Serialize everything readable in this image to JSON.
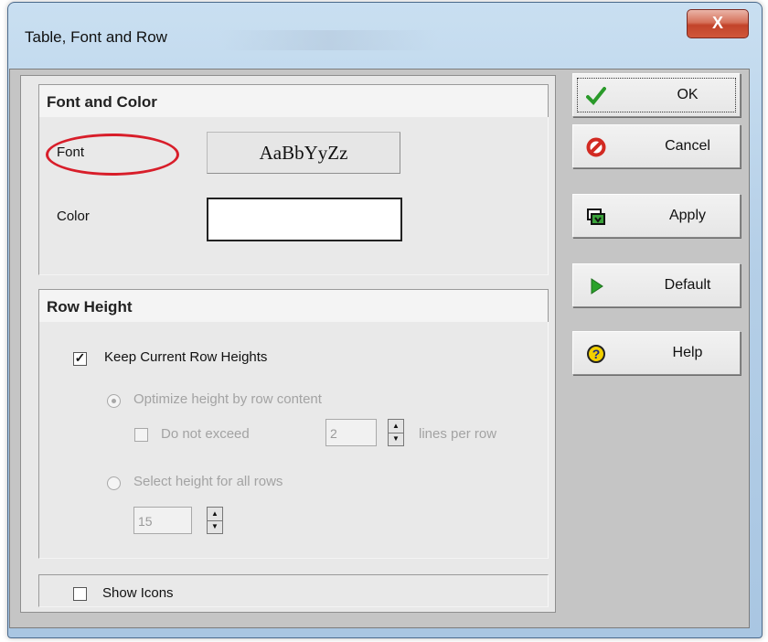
{
  "window": {
    "title": "Table, Font and Row",
    "close_label": "X"
  },
  "font_color": {
    "header": "Font and Color",
    "font_label": "Font",
    "font_preview": "AaBbYyZz",
    "color_label": "Color",
    "color_value": "#ffffff"
  },
  "row_height": {
    "header": "Row Height",
    "keep_current": {
      "label": "Keep Current Row Heights",
      "checked": true
    },
    "optimize": {
      "label": "Optimize height by row content",
      "selected": true,
      "enabled": false
    },
    "do_not_exceed": {
      "label": "Do not exceed",
      "checked": false,
      "value": "2",
      "suffix": "lines per row"
    },
    "select_height": {
      "label": "Select height for all rows",
      "selected": false,
      "value": "15"
    }
  },
  "show_icons": {
    "label": "Show Icons",
    "checked": false
  },
  "buttons": {
    "ok": "OK",
    "cancel": "Cancel",
    "apply": "Apply",
    "default": "Default",
    "help": "Help"
  },
  "colors": {
    "annotation_ring": "#d81e2a",
    "close_button": "#c2432a",
    "ok_icon": "#2a9a2a",
    "cancel_icon": "#d22a22",
    "help_icon": "#f2d000"
  }
}
